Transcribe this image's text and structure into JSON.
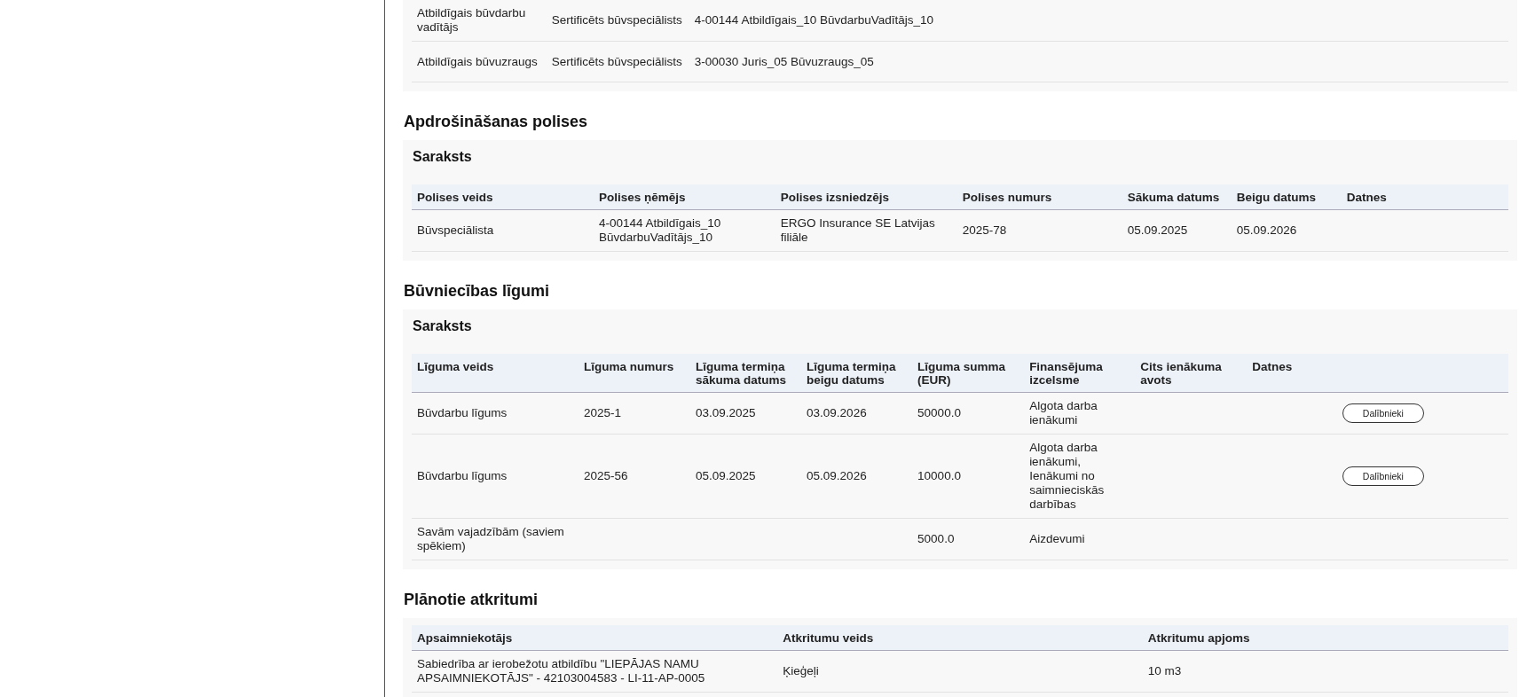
{
  "responsible_persons": {
    "rows": [
      [
        "Atbildīgais būvdarbu vadītājs",
        "Sertificēts būvspeciālists",
        "4-00144 Atbildīgais_10 BūvdarbuVadītājs_10"
      ],
      [
        "Atbildīgais būvuzraugs",
        "Sertificēts būvspeciālists",
        "3-00030 Juris_05 Būvuzraugs_05"
      ]
    ]
  },
  "insurance": {
    "title": "Apdrošināšanas polises",
    "list_title": "Saraksts",
    "columns": [
      "Polises veids",
      "Polises ņēmējs",
      "Polises izsniedzējs",
      "Polises numurs",
      "Sākuma datums",
      "Beigu datums",
      "Datnes"
    ],
    "rows": [
      [
        "Būvspeciālista",
        "4-00144 Atbildīgais_10 BūvdarbuVadītājs_10",
        "ERGO Insurance SE Latvijas filiāle",
        "2025-78",
        "05.09.2025",
        "05.09.2026",
        ""
      ]
    ]
  },
  "contracts": {
    "title": "Būvniecības līgumi",
    "list_title": "Saraksts",
    "columns": [
      "Līguma veids",
      "Līguma numurs",
      "Līguma termiņa sākuma datums",
      "Līguma termiņa beigu datums",
      "Līguma summa (EUR)",
      "Finansējuma izcelsme",
      "Cits ienākuma avots",
      "Datnes"
    ],
    "rows": [
      {
        "cells": [
          "Būvdarbu līgums",
          "2025-1",
          "03.09.2025",
          "03.09.2026",
          "50000.0",
          "Algota darba ienākumi",
          "",
          ""
        ],
        "button": "Dalībnieki"
      },
      {
        "cells": [
          "Būvdarbu līgums",
          "2025-56",
          "05.09.2025",
          "05.09.2026",
          "10000.0",
          "Algota darba ienākumi, Ienākumi no saimnieciskās darbības",
          "",
          ""
        ],
        "button": "Dalībnieki"
      },
      {
        "cells": [
          "Savām vajadzībām (saviem spēkiem)",
          "",
          "",
          "",
          "5000.0",
          "Aizdevumi",
          "",
          ""
        ]
      }
    ]
  },
  "waste": {
    "title": "Plānotie atkritumi",
    "columns": [
      "Apsaimniekotājs",
      "Atkritumu veids",
      "Atkritumu apjoms"
    ],
    "rows": [
      [
        "Sabiedrība ar ierobežotu atbildību \"LIEPĀJAS NAMU APSAIMNIEKOTĀJS\" - 42103004583 - LI-11-AP-0005",
        "Ķieģeļi",
        "10 m3"
      ]
    ]
  }
}
